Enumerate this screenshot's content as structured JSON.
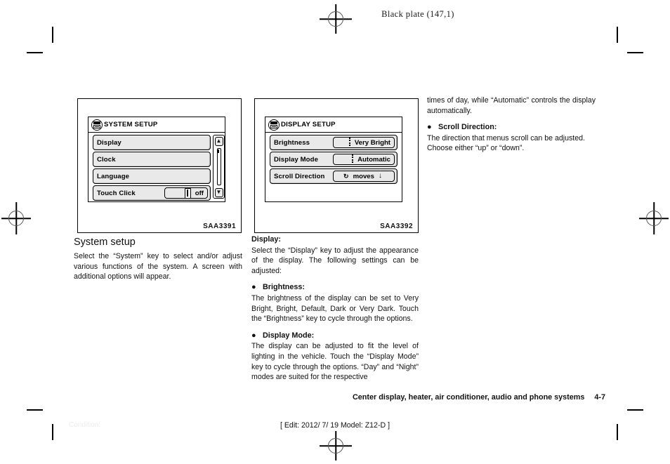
{
  "page": {
    "black_plate": "Black plate (147,1)",
    "running_footer": "Center display, heater, air conditioner, audio and phone systems",
    "page_number": "4-7",
    "edit_line": "[ Edit: 2012/ 7/ 19   Model: Z12-D ]",
    "condition_watermark": "Condition:"
  },
  "figures": [
    {
      "code": "SAA3391",
      "title": "SYSTEM SETUP",
      "icon": "system-setup-icon",
      "rows": [
        {
          "label": "Display",
          "value": "",
          "widget": "none"
        },
        {
          "label": "Clock",
          "value": "",
          "widget": "none"
        },
        {
          "label": "Language",
          "value": "",
          "widget": "none"
        },
        {
          "label": "Touch Click",
          "value": "off",
          "widget": "slider"
        }
      ],
      "scrollbar": {
        "up": "▲",
        "down": "▼"
      }
    },
    {
      "code": "SAA3392",
      "title": "DISPLAY SETUP",
      "icon": "display-setup-icon",
      "rows": [
        {
          "label": "Brightness",
          "value": "Very Bright",
          "widget": "dots"
        },
        {
          "label": "Display Mode",
          "value": "Automatic",
          "widget": "dots"
        },
        {
          "label": "Scroll Direction",
          "value": "moves",
          "widget": "cycle",
          "cycle_glyph": "↻",
          "arrow": "↓"
        }
      ]
    }
  ],
  "column1": {
    "heading": "System setup",
    "body": "Select the “System” key to select and/or adjust various functions of the system. A screen with additional options will appear."
  },
  "column2": {
    "heading": "Display:",
    "intro": "Select the “Display” key to adjust the appearance of the display. The following settings can be adjusted:",
    "bullets": [
      {
        "marker": "●",
        "title": "Brightness:",
        "body": "The brightness of the display can be set to Very Bright, Bright, Default, Dark or Very Dark. Touch the “Brightness” key to cycle through the options."
      },
      {
        "marker": "●",
        "title": "Display Mode:",
        "body": "The display can be adjusted to fit the level of lighting in the vehicle. Touch the “Display Mode” key to cycle through the options. “Day” and “Night” modes are suited for the respective"
      }
    ]
  },
  "column3": {
    "continuation": "times of day, while “Automatic” controls the display automatically.",
    "bullets": [
      {
        "marker": "●",
        "title": "Scroll Direction:",
        "body": "The direction that menus scroll can be adjusted. Choose either “up” or “down”."
      }
    ]
  }
}
